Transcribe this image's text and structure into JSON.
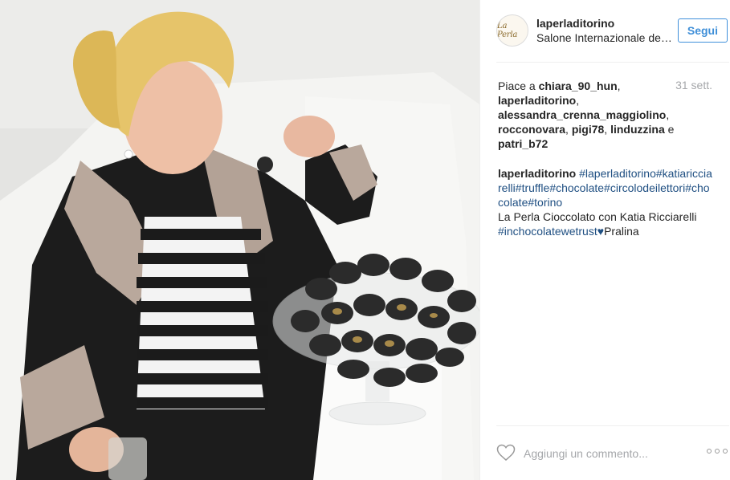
{
  "post": {
    "photo_alt": "Woman with curly blonde hair holding a wrapped chocolate next to a glass bowl of chocolates",
    "username": "laperladitorino",
    "location": "Salone Internazionale del Libro",
    "avatar_text": "La Perla",
    "follow_label": "Segui",
    "likes": {
      "prefix": "Piace a ",
      "users": [
        "chiara_90_hun",
        "laperladitorino",
        "alessandra_crenna_maggiolino",
        "rocconovara",
        "pigi78",
        "linduzzina"
      ],
      "last_joiner": " e ",
      "last_user": "patri_b72"
    },
    "time_ago": "31 sett.",
    "caption": {
      "user": "laperladitorino",
      "tags_line": "#laperladitorino#katiaricciarelli#truffle#chocolate#circolodeilettori#chocolate#torino",
      "text": "La Perla Cioccolato con Katia Ricciarelli",
      "tag2": "#inchocolatewetrust",
      "heart": "♥",
      "tail": "Pralina"
    },
    "comment_placeholder": "Aggiungi un commento...",
    "icons": {
      "like": "heart-outline-icon",
      "more": "more-options-icon"
    }
  },
  "colors": {
    "accent": "#3f8fd8",
    "hashtag": "#1f4f82",
    "muted": "#a5a7aa",
    "text": "#262626"
  }
}
